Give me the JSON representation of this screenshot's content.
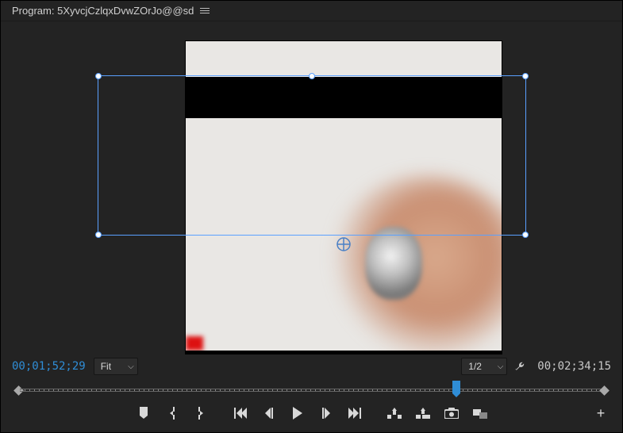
{
  "header": {
    "title_prefix": "Program:",
    "sequence_name": "5XyvcjCzlqxDvwZOrJo@@sd"
  },
  "timecode": {
    "current": "00;01;52;29",
    "total": "00;02;34;15"
  },
  "dropdowns": {
    "zoom": {
      "label": "Fit"
    },
    "resolution": {
      "label": "1/2"
    }
  },
  "playhead_percent": 73.6,
  "transport": {
    "add_marker": "Add Marker",
    "mark_in": "Mark In",
    "mark_out": "Mark Out",
    "go_in": "Go to In",
    "step_back": "Step Back",
    "play": "Play",
    "step_fwd": "Step Forward",
    "go_out": "Go to Out",
    "lift": "Lift",
    "extract": "Extract",
    "export_frame": "Export Frame",
    "comparison": "Comparison View"
  }
}
